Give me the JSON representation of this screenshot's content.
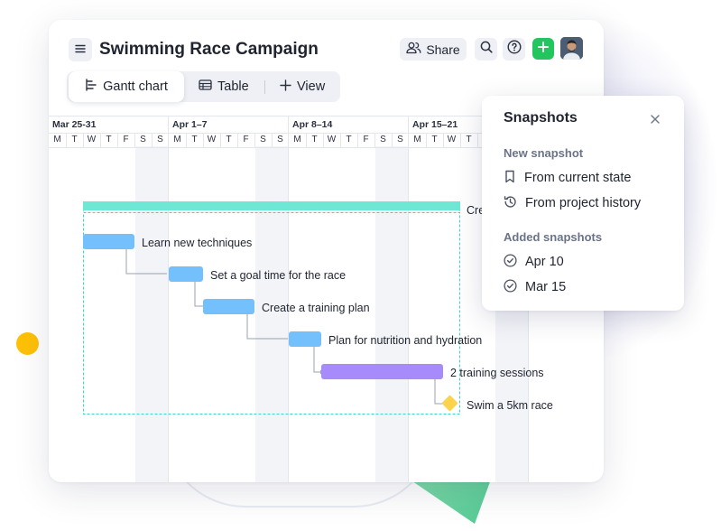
{
  "project": {
    "title": "Swimming Race Campaign"
  },
  "toolbar": {
    "share_label": "Share"
  },
  "views": {
    "tabs": [
      {
        "label": "Gantt chart",
        "active": true
      },
      {
        "label": "Table",
        "active": false
      },
      {
        "label": "View",
        "active": false
      }
    ]
  },
  "timeline": {
    "weeks": [
      "Mar 25-31",
      "Apr 1–7",
      "Apr 8–14",
      "Apr 15–21"
    ],
    "day_letters": [
      "M",
      "T",
      "W",
      "T",
      "F",
      "S",
      "S"
    ]
  },
  "gantt": {
    "group_label": "Cre",
    "tasks": [
      {
        "label": "Learn new techniques"
      },
      {
        "label": "Set a goal time for the race"
      },
      {
        "label": "Create a training plan"
      },
      {
        "label": "Plan for nutrition and hydration"
      },
      {
        "label": "2 training sessions"
      },
      {
        "label": "Swim a 5km race"
      }
    ]
  },
  "snapshots": {
    "title": "Snapshots",
    "new_heading": "New snapshot",
    "new_options": [
      {
        "label": "From current state",
        "icon": "bookmark-icon"
      },
      {
        "label": "From project history",
        "icon": "history-icon"
      }
    ],
    "added_heading": "Added snapshots",
    "added": [
      {
        "label": "Apr 10",
        "icon": "check-circle-icon"
      },
      {
        "label": "Mar 15",
        "icon": "check-circle-icon"
      }
    ]
  },
  "colors": {
    "group_bar": "#6ee7d4",
    "task_bar": "#74c0fc",
    "highlight_bar": "#a78bfa",
    "milestone": "#fcd34d",
    "accent_green": "#22c55e"
  }
}
